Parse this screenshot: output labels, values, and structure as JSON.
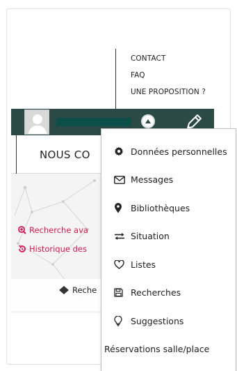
{
  "top_links": {
    "contact": "CONTACT",
    "faq": "FAQ",
    "proposal": "UNE PROPOSITION ?"
  },
  "user_bar": {
    "color": "#2c4a45"
  },
  "nav": {
    "label": "NOUS CO"
  },
  "hero": {
    "advanced_search": "Recherche ava",
    "history": "Historique des",
    "search_button": "Reche"
  },
  "user_menu": {
    "items": [
      {
        "label": "Données personnelles",
        "icon": "gear-icon"
      },
      {
        "label": "Messages",
        "icon": "envelope-icon"
      },
      {
        "label": "Bibliothèques",
        "icon": "map-pin-icon"
      },
      {
        "label": "Situation",
        "icon": "exchange-icon"
      },
      {
        "label": "Listes",
        "icon": "heart-icon"
      },
      {
        "label": "Recherches",
        "icon": "save-icon"
      },
      {
        "label": "Suggestions",
        "icon": "lightbulb-icon"
      },
      {
        "label": "Réservations salle/place",
        "icon": ""
      }
    ]
  },
  "colors": {
    "accent": "#d3174f",
    "bar": "#2c4a45"
  }
}
